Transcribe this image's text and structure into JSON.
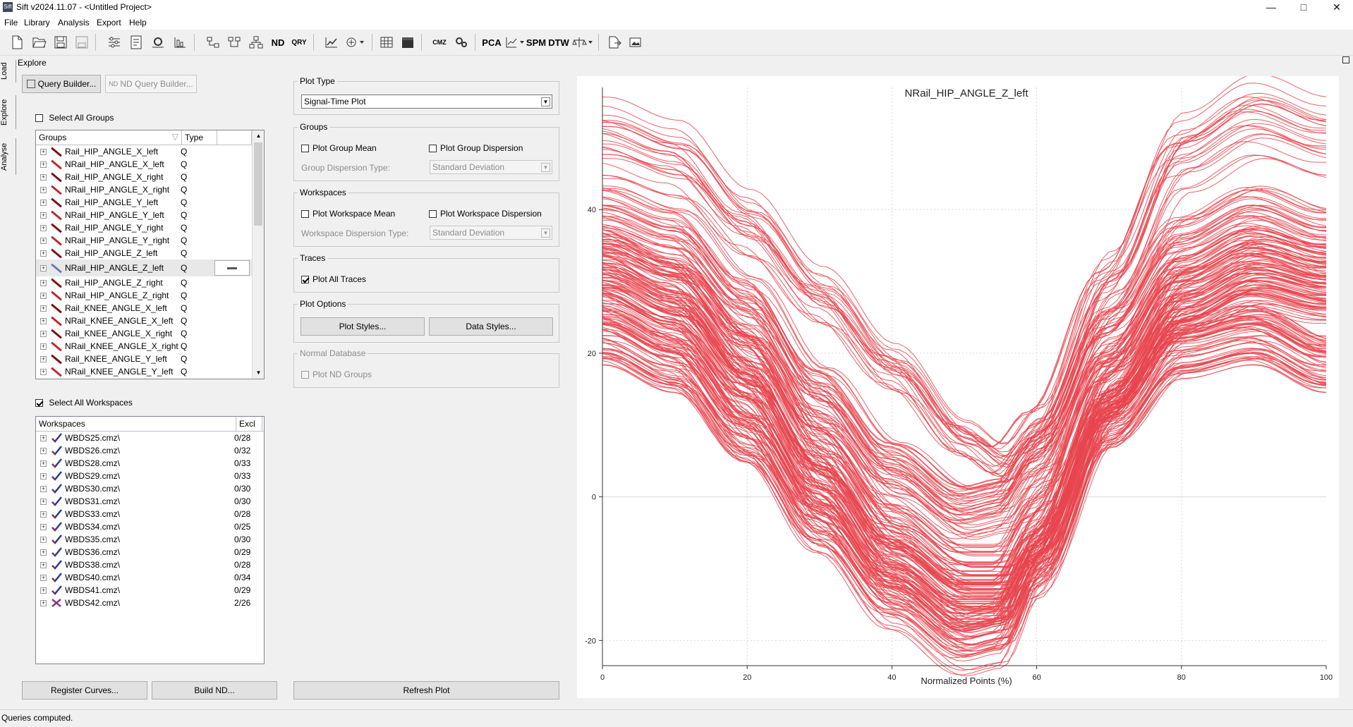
{
  "window": {
    "title": "Sift v2024.11.07 - <Untitled Project>",
    "app_icon_text": "Sift",
    "minimize": "—",
    "maximize": "□",
    "close": "✕"
  },
  "menu": [
    "File",
    "Library",
    "Analysis",
    "Export",
    "Help"
  ],
  "toolbar": {
    "icons": [
      "new-icon",
      "open-icon",
      "save-icon",
      "save-as-icon",
      "settings-sliders-icon",
      "report-icon",
      "gear-box-icon",
      "chart-box-icon",
      "group-tree-icon",
      "group-tree-2-icon",
      "hierarchy-icon",
      "nd-label",
      "qry-label",
      "line-chart-icon",
      "circle-chart-dropdown-icon",
      "matrix-icon",
      "clapper-icon",
      "cmz-icon",
      "cog-cluster-icon",
      "pca-label",
      "trend-dropdown-icon",
      "spm-label",
      "dtw-label",
      "balance-dropdown-icon",
      "export-icon",
      "image-export-icon"
    ],
    "labels": {
      "nd": "ND",
      "qry": "QRY",
      "cmz": "CMZ",
      "pca": "PCA",
      "spm": "SPM",
      "dtw": "DTW"
    }
  },
  "side_tabs": [
    "Load",
    "Explore",
    "Analyse"
  ],
  "explore": {
    "title": "Explore",
    "query_builder": "Query Builder...",
    "nd_query_builder": "ND Query Builder...",
    "select_all_groups": "Select All Groups",
    "select_all_groups_checked": false,
    "groups_header": {
      "name": "Groups",
      "type": "Type"
    },
    "groups": [
      {
        "name": "Rail_HIP_ANGLE_X_left",
        "type": "Q",
        "color": "#7a1010"
      },
      {
        "name": "NRail_HIP_ANGLE_X_left",
        "type": "Q",
        "color": "#c0282d"
      },
      {
        "name": "Rail_HIP_ANGLE_X_right",
        "type": "Q",
        "color": "#7a1010"
      },
      {
        "name": "NRail_HIP_ANGLE_X_right",
        "type": "Q",
        "color": "#c0282d"
      },
      {
        "name": "Rail_HIP_ANGLE_Y_left",
        "type": "Q",
        "color": "#7a1010"
      },
      {
        "name": "NRail_HIP_ANGLE_Y_left",
        "type": "Q",
        "color": "#c0282d"
      },
      {
        "name": "Rail_HIP_ANGLE_Y_right",
        "type": "Q",
        "color": "#7a1010"
      },
      {
        "name": "NRail_HIP_ANGLE_Y_right",
        "type": "Q",
        "color": "#c0282d"
      },
      {
        "name": "Rail_HIP_ANGLE_Z_left",
        "type": "Q",
        "color": "#7a1010"
      },
      {
        "name": "NRail_HIP_ANGLE_Z_left",
        "type": "Q",
        "color": "#6a7bb5"
      },
      {
        "name": "Rail_HIP_ANGLE_Z_right",
        "type": "Q",
        "color": "#7a1010"
      },
      {
        "name": "NRail_HIP_ANGLE_Z_right",
        "type": "Q",
        "color": "#c0282d"
      },
      {
        "name": "Rail_KNEE_ANGLE_X_left",
        "type": "Q",
        "color": "#7a1010"
      },
      {
        "name": "NRail_KNEE_ANGLE_X_left",
        "type": "Q",
        "color": "#c0282d"
      },
      {
        "name": "Rail_KNEE_ANGLE_X_right",
        "type": "Q",
        "color": "#7a1010"
      },
      {
        "name": "NRail_KNEE_ANGLE_X_right",
        "type": "Q",
        "color": "#c0282d"
      },
      {
        "name": "Rail_KNEE_ANGLE_Y_left",
        "type": "Q",
        "color": "#7a1010"
      },
      {
        "name": "NRail_KNEE_ANGLE_Y_left",
        "type": "Q",
        "color": "#c0282d"
      }
    ],
    "select_all_workspaces": "Select All Workspaces",
    "select_all_workspaces_checked": true,
    "workspaces_header": {
      "name": "Workspaces",
      "excl": "Excl"
    },
    "workspaces": [
      {
        "name": "WBDS25.cmz\\",
        "excl": "0/28",
        "status": "check"
      },
      {
        "name": "WBDS26.cmz\\",
        "excl": "0/32",
        "status": "check"
      },
      {
        "name": "WBDS28.cmz\\",
        "excl": "0/33",
        "status": "check"
      },
      {
        "name": "WBDS29.cmz\\",
        "excl": "0/33",
        "status": "check"
      },
      {
        "name": "WBDS30.cmz\\",
        "excl": "0/30",
        "status": "check"
      },
      {
        "name": "WBDS31.cmz\\",
        "excl": "0/30",
        "status": "check"
      },
      {
        "name": "WBDS33.cmz\\",
        "excl": "0/28",
        "status": "check"
      },
      {
        "name": "WBDS34.cmz\\",
        "excl": "0/25",
        "status": "check"
      },
      {
        "name": "WBDS35.cmz\\",
        "excl": "0/30",
        "status": "check"
      },
      {
        "name": "WBDS36.cmz\\",
        "excl": "0/29",
        "status": "check"
      },
      {
        "name": "WBDS38.cmz\\",
        "excl": "0/28",
        "status": "check"
      },
      {
        "name": "WBDS40.cmz\\",
        "excl": "0/34",
        "status": "check"
      },
      {
        "name": "WBDS41.cmz\\",
        "excl": "0/29",
        "status": "check"
      },
      {
        "name": "WBDS42.cmz\\",
        "excl": "2/26",
        "status": "cross"
      }
    ],
    "register_curves": "Register Curves...",
    "build_nd": "Build ND..."
  },
  "options": {
    "plot_type_legend": "Plot Type",
    "plot_type_value": "Signal-Time Plot",
    "groups_legend": "Groups",
    "plot_group_mean": "Plot Group Mean",
    "plot_group_dispersion": "Plot Group Dispersion",
    "group_dispersion_type_label": "Group Dispersion Type:",
    "group_dispersion_type_value": "Standard Deviation",
    "workspaces_legend": "Workspaces",
    "plot_workspace_mean": "Plot Workspace Mean",
    "plot_workspace_dispersion": "Plot Workspace Dispersion",
    "workspace_dispersion_type_label": "Workspace Dispersion Type:",
    "workspace_dispersion_type_value": "Standard Deviation",
    "traces_legend": "Traces",
    "plot_all_traces": "Plot All Traces",
    "plot_all_traces_checked": true,
    "plot_options_legend": "Plot Options",
    "plot_styles": "Plot Styles...",
    "data_styles": "Data Styles...",
    "normal_db_legend": "Normal Database",
    "plot_nd_groups": "Plot ND Groups",
    "refresh_plot": "Refresh Plot"
  },
  "chart_data": {
    "type": "line",
    "title": "NRail_HIP_ANGLE_Z_left",
    "xlabel": "Normalized Points (%)",
    "ylabel": "",
    "xlim": [
      0,
      100
    ],
    "ylim": [
      -23.5,
      57
    ],
    "xticks": [
      0,
      20,
      40,
      60,
      80,
      100
    ],
    "yticks": [
      -20,
      0,
      20,
      40
    ],
    "grid": true,
    "color": "#e8454f",
    "series_bands": [
      {
        "name": "",
        "x": [
          0,
          10,
          20,
          30,
          40,
          50,
          55,
          60,
          70,
          80,
          90,
          100
        ],
        "center": [
          50,
          47,
          38,
          28,
          18,
          8,
          5,
          10,
          30,
          48,
          53,
          50
        ],
        "spread": 2.5,
        "count": 25
      },
      {
        "name": "",
        "x": [
          0,
          10,
          20,
          30,
          40,
          50,
          55,
          60,
          70,
          80,
          90,
          100
        ],
        "center": [
          38,
          35,
          26,
          14,
          4,
          -2,
          -1,
          5,
          22,
          34,
          38,
          35
        ],
        "spread": 4,
        "count": 45
      },
      {
        "name": "",
        "x": [
          0,
          10,
          20,
          30,
          40,
          50,
          55,
          60,
          70,
          80,
          90,
          100
        ],
        "center": [
          32,
          28,
          18,
          5,
          -6,
          -12,
          -12,
          -5,
          15,
          28,
          32,
          30
        ],
        "spread": 5,
        "count": 90
      },
      {
        "name": "",
        "x": [
          0,
          10,
          20,
          30,
          40,
          50,
          55,
          60,
          70,
          80,
          90,
          100
        ],
        "center": [
          22,
          18,
          8,
          -4,
          -14,
          -20,
          -19,
          -10,
          10,
          20,
          22,
          18
        ],
        "spread": 3.5,
        "count": 60
      }
    ]
  },
  "status": "Queries computed."
}
